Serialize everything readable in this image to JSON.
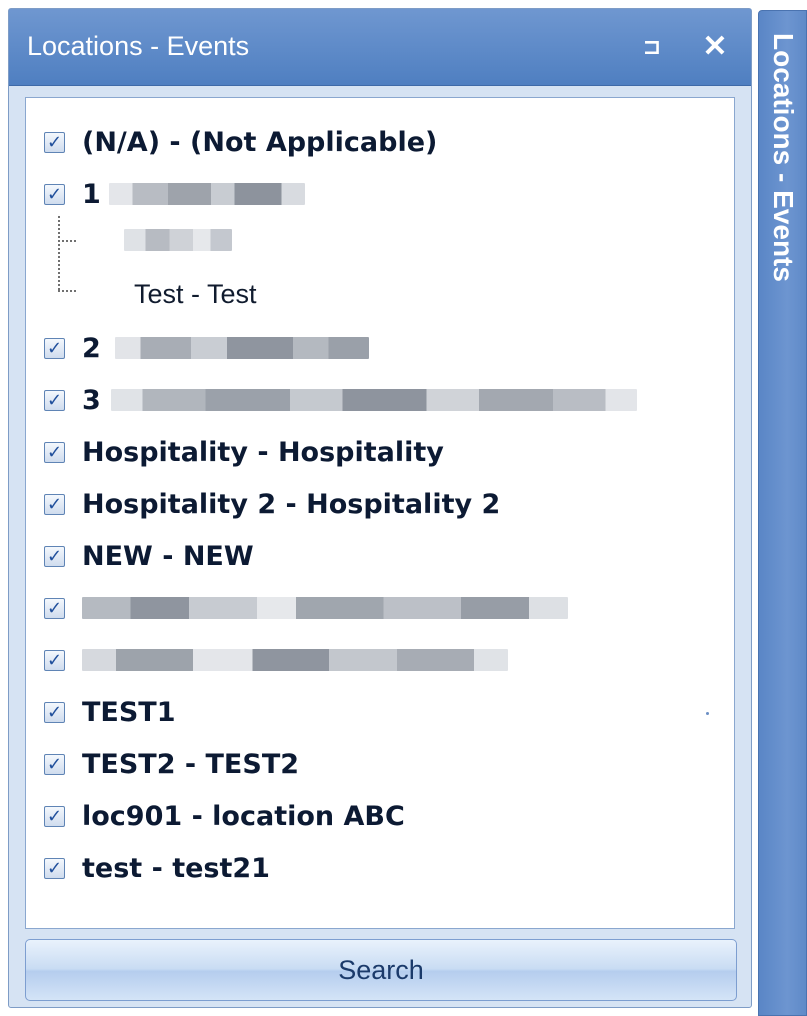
{
  "panel": {
    "title": "Locations - Events",
    "pin_glyph": "⊐",
    "close_glyph": "✕",
    "search_label": "Search"
  },
  "side_tab": {
    "label": "Locations - Events"
  },
  "items": [
    {
      "label": "(N/A) - (Not Applicable)",
      "checked": true
    },
    {
      "label": "1",
      "checked": true,
      "obscured": true
    },
    {
      "label": "",
      "child": true,
      "obscured": true
    },
    {
      "label": "Test - Test",
      "child": true
    },
    {
      "label": "2",
      "checked": true,
      "obscured": true
    },
    {
      "label": "3",
      "checked": true,
      "obscured": true
    },
    {
      "label": "Hospitality - Hospitality",
      "checked": true
    },
    {
      "label": "Hospitality 2 - Hospitality 2",
      "checked": true
    },
    {
      "label": "NEW - NEW",
      "checked": true
    },
    {
      "label": "",
      "checked": true,
      "obscured": true
    },
    {
      "label": "",
      "checked": true,
      "obscured": true
    },
    {
      "label": "TEST1",
      "checked": true
    },
    {
      "label": "TEST2 - TEST2",
      "checked": true
    },
    {
      "label": "loc901 - location ABC",
      "checked": true
    },
    {
      "label": "test - test21",
      "checked": true
    }
  ],
  "check_glyph": "✓",
  "colors": {
    "title_bar": "#5a87c6",
    "side_tab": "#6690cc",
    "panel_bg": "#d6e3f3"
  }
}
